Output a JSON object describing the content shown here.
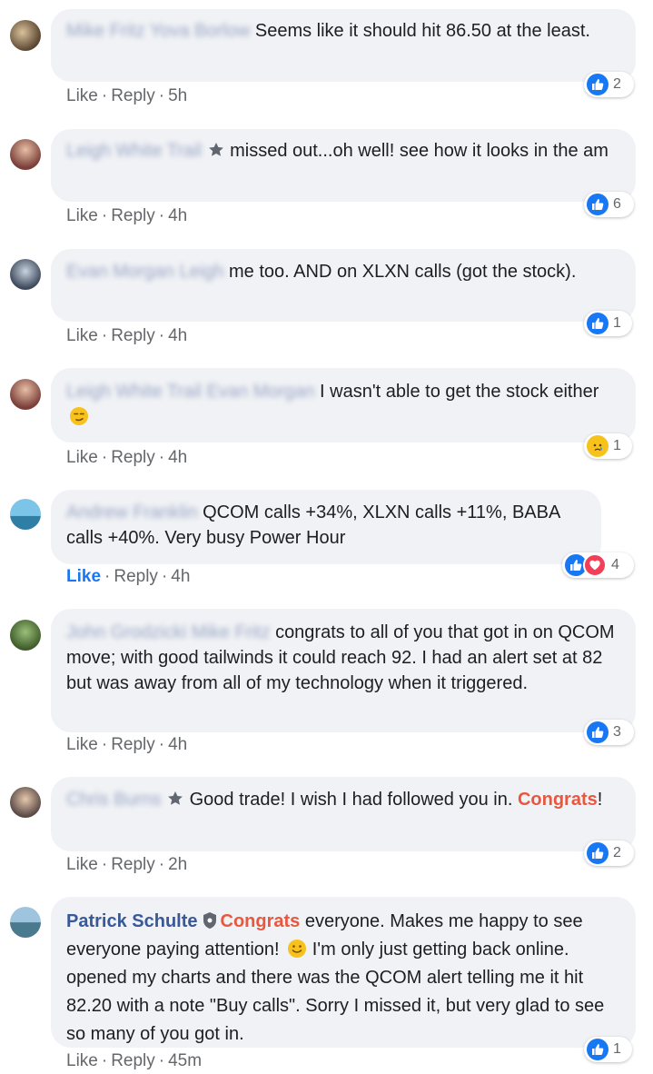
{
  "comments": [
    {
      "name": "Mike Fritz Yova Borlow",
      "text": "Seems like it should hit 86.50 at the least.",
      "actions": {
        "like": "Like",
        "reply": "Reply",
        "time": "5h"
      },
      "reaction_count": "2"
    },
    {
      "name": "Leigh White Trail",
      "text": "missed out...oh well! see how it looks in the am",
      "actions": {
        "like": "Like",
        "reply": "Reply",
        "time": "4h"
      },
      "reaction_count": "6"
    },
    {
      "name": "Evan Morgan Leigh",
      "text": "me too. AND on XLXN calls (got the stock).",
      "actions": {
        "like": "Like",
        "reply": "Reply",
        "time": "4h"
      },
      "reaction_count": "1"
    },
    {
      "name": "Leigh White Trail Evan Morgan",
      "text": "I wasn't able to get the stock either",
      "actions": {
        "like": "Like",
        "reply": "Reply",
        "time": "4h"
      },
      "reaction_count": "1"
    },
    {
      "name": "Andrew Franklin",
      "text": "QCOM calls +34%, XLXN calls +11%, BABA calls +40%. Very busy Power Hour",
      "actions": {
        "like": "Like",
        "reply": "Reply",
        "time": "4h"
      },
      "reaction_count": "4"
    },
    {
      "name": "John Grodzicki Mike Fritz",
      "text": "congrats to all of you that got in on QCOM move; with good tailwinds it could reach 92. I had an alert set at 82 but was away from all of my technology when it triggered.",
      "actions": {
        "like": "Like",
        "reply": "Reply",
        "time": "4h"
      },
      "reaction_count": "3"
    },
    {
      "name": "Chris Burns",
      "text": "Good trade! I wish I had followed you in.",
      "highlight": "Congrats",
      "text_after": "!",
      "actions": {
        "like": "Like",
        "reply": "Reply",
        "time": "2h"
      },
      "reaction_count": "2"
    },
    {
      "name": "Patrick Schulte",
      "highlight": "Congrats",
      "text": "everyone. Makes me happy to see everyone paying attention!",
      "text_after": "I'm only just getting back online. opened my charts and there was the QCOM alert telling me it hit 82.20 with a note \"Buy calls\". Sorry I missed it, but very glad to see so many of you got in.",
      "actions": {
        "like": "Like",
        "reply": "Reply",
        "time": "45m"
      },
      "reaction_count": "1"
    }
  ],
  "colors": {
    "like_blue": "#1877f2",
    "name_blue": "#385898",
    "bubble_bg": "#f0f2f5",
    "congrats": "#e9573f"
  }
}
